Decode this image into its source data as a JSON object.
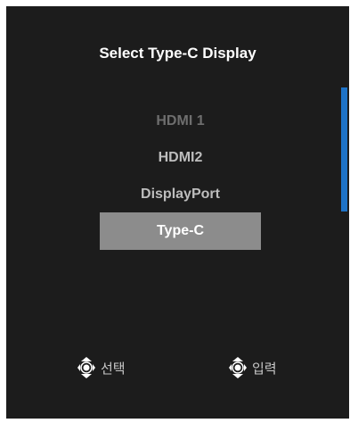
{
  "osd": {
    "title": "Select Type-C Display",
    "options": [
      {
        "label": "HDMI 1",
        "state": "disabled"
      },
      {
        "label": "HDMI2",
        "state": "normal"
      },
      {
        "label": "DisplayPort",
        "state": "normal"
      },
      {
        "label": "Type-C",
        "state": "selected"
      }
    ],
    "scrollbar_color": "#1e73c8",
    "footer": {
      "select_label": "선택",
      "select_icon": "joystick-updown-icon",
      "enter_label": "입력",
      "enter_icon": "joystick-press-icon"
    }
  }
}
